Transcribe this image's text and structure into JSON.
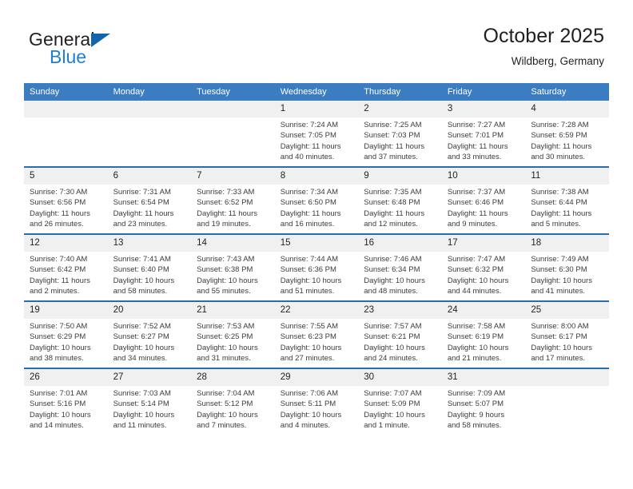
{
  "brand": {
    "name_dark": "General",
    "name_blue": "Blue",
    "triangle_color": "#1265ad",
    "blue_color": "#1d7fd4"
  },
  "header": {
    "title": "October 2025",
    "subtitle": "Wildberg, Germany"
  },
  "theme": {
    "header_row_bg": "#3b7dc0",
    "week_rule": "#2b6cad",
    "daynum_bg": "#f0f0f0",
    "text": "#231f20"
  },
  "weekdays": [
    "Sunday",
    "Monday",
    "Tuesday",
    "Wednesday",
    "Thursday",
    "Friday",
    "Saturday"
  ],
  "weeks": [
    [
      {
        "day": "",
        "lines": []
      },
      {
        "day": "",
        "lines": []
      },
      {
        "day": "",
        "lines": []
      },
      {
        "day": "1",
        "lines": [
          "Sunrise: 7:24 AM",
          "Sunset: 7:05 PM",
          "Daylight: 11 hours",
          "and 40 minutes."
        ]
      },
      {
        "day": "2",
        "lines": [
          "Sunrise: 7:25 AM",
          "Sunset: 7:03 PM",
          "Daylight: 11 hours",
          "and 37 minutes."
        ]
      },
      {
        "day": "3",
        "lines": [
          "Sunrise: 7:27 AM",
          "Sunset: 7:01 PM",
          "Daylight: 11 hours",
          "and 33 minutes."
        ]
      },
      {
        "day": "4",
        "lines": [
          "Sunrise: 7:28 AM",
          "Sunset: 6:59 PM",
          "Daylight: 11 hours",
          "and 30 minutes."
        ]
      }
    ],
    [
      {
        "day": "5",
        "lines": [
          "Sunrise: 7:30 AM",
          "Sunset: 6:56 PM",
          "Daylight: 11 hours",
          "and 26 minutes."
        ]
      },
      {
        "day": "6",
        "lines": [
          "Sunrise: 7:31 AM",
          "Sunset: 6:54 PM",
          "Daylight: 11 hours",
          "and 23 minutes."
        ]
      },
      {
        "day": "7",
        "lines": [
          "Sunrise: 7:33 AM",
          "Sunset: 6:52 PM",
          "Daylight: 11 hours",
          "and 19 minutes."
        ]
      },
      {
        "day": "8",
        "lines": [
          "Sunrise: 7:34 AM",
          "Sunset: 6:50 PM",
          "Daylight: 11 hours",
          "and 16 minutes."
        ]
      },
      {
        "day": "9",
        "lines": [
          "Sunrise: 7:35 AM",
          "Sunset: 6:48 PM",
          "Daylight: 11 hours",
          "and 12 minutes."
        ]
      },
      {
        "day": "10",
        "lines": [
          "Sunrise: 7:37 AM",
          "Sunset: 6:46 PM",
          "Daylight: 11 hours",
          "and 9 minutes."
        ]
      },
      {
        "day": "11",
        "lines": [
          "Sunrise: 7:38 AM",
          "Sunset: 6:44 PM",
          "Daylight: 11 hours",
          "and 5 minutes."
        ]
      }
    ],
    [
      {
        "day": "12",
        "lines": [
          "Sunrise: 7:40 AM",
          "Sunset: 6:42 PM",
          "Daylight: 11 hours",
          "and 2 minutes."
        ]
      },
      {
        "day": "13",
        "lines": [
          "Sunrise: 7:41 AM",
          "Sunset: 6:40 PM",
          "Daylight: 10 hours",
          "and 58 minutes."
        ]
      },
      {
        "day": "14",
        "lines": [
          "Sunrise: 7:43 AM",
          "Sunset: 6:38 PM",
          "Daylight: 10 hours",
          "and 55 minutes."
        ]
      },
      {
        "day": "15",
        "lines": [
          "Sunrise: 7:44 AM",
          "Sunset: 6:36 PM",
          "Daylight: 10 hours",
          "and 51 minutes."
        ]
      },
      {
        "day": "16",
        "lines": [
          "Sunrise: 7:46 AM",
          "Sunset: 6:34 PM",
          "Daylight: 10 hours",
          "and 48 minutes."
        ]
      },
      {
        "day": "17",
        "lines": [
          "Sunrise: 7:47 AM",
          "Sunset: 6:32 PM",
          "Daylight: 10 hours",
          "and 44 minutes."
        ]
      },
      {
        "day": "18",
        "lines": [
          "Sunrise: 7:49 AM",
          "Sunset: 6:30 PM",
          "Daylight: 10 hours",
          "and 41 minutes."
        ]
      }
    ],
    [
      {
        "day": "19",
        "lines": [
          "Sunrise: 7:50 AM",
          "Sunset: 6:29 PM",
          "Daylight: 10 hours",
          "and 38 minutes."
        ]
      },
      {
        "day": "20",
        "lines": [
          "Sunrise: 7:52 AM",
          "Sunset: 6:27 PM",
          "Daylight: 10 hours",
          "and 34 minutes."
        ]
      },
      {
        "day": "21",
        "lines": [
          "Sunrise: 7:53 AM",
          "Sunset: 6:25 PM",
          "Daylight: 10 hours",
          "and 31 minutes."
        ]
      },
      {
        "day": "22",
        "lines": [
          "Sunrise: 7:55 AM",
          "Sunset: 6:23 PM",
          "Daylight: 10 hours",
          "and 27 minutes."
        ]
      },
      {
        "day": "23",
        "lines": [
          "Sunrise: 7:57 AM",
          "Sunset: 6:21 PM",
          "Daylight: 10 hours",
          "and 24 minutes."
        ]
      },
      {
        "day": "24",
        "lines": [
          "Sunrise: 7:58 AM",
          "Sunset: 6:19 PM",
          "Daylight: 10 hours",
          "and 21 minutes."
        ]
      },
      {
        "day": "25",
        "lines": [
          "Sunrise: 8:00 AM",
          "Sunset: 6:17 PM",
          "Daylight: 10 hours",
          "and 17 minutes."
        ]
      }
    ],
    [
      {
        "day": "26",
        "lines": [
          "Sunrise: 7:01 AM",
          "Sunset: 5:16 PM",
          "Daylight: 10 hours",
          "and 14 minutes."
        ]
      },
      {
        "day": "27",
        "lines": [
          "Sunrise: 7:03 AM",
          "Sunset: 5:14 PM",
          "Daylight: 10 hours",
          "and 11 minutes."
        ]
      },
      {
        "day": "28",
        "lines": [
          "Sunrise: 7:04 AM",
          "Sunset: 5:12 PM",
          "Daylight: 10 hours",
          "and 7 minutes."
        ]
      },
      {
        "day": "29",
        "lines": [
          "Sunrise: 7:06 AM",
          "Sunset: 5:11 PM",
          "Daylight: 10 hours",
          "and 4 minutes."
        ]
      },
      {
        "day": "30",
        "lines": [
          "Sunrise: 7:07 AM",
          "Sunset: 5:09 PM",
          "Daylight: 10 hours",
          "and 1 minute."
        ]
      },
      {
        "day": "31",
        "lines": [
          "Sunrise: 7:09 AM",
          "Sunset: 5:07 PM",
          "Daylight: 9 hours",
          "and 58 minutes."
        ]
      },
      {
        "day": "",
        "lines": []
      }
    ]
  ]
}
